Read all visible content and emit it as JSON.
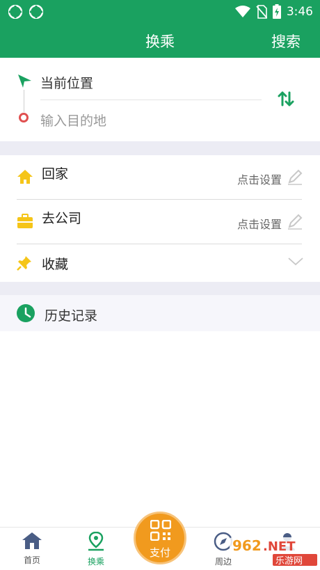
{
  "status_bar": {
    "time": "3:46",
    "icons": [
      "app-icon",
      "app-icon",
      "wifi-icon",
      "no-sim-icon",
      "battery-charging-icon"
    ]
  },
  "header": {
    "title": "换乘",
    "search_label": "搜索"
  },
  "route": {
    "from_label": "当前位置",
    "to_placeholder": "输入目的地",
    "swap_icon": "swap-vertical-icon"
  },
  "places": [
    {
      "name": "回家",
      "hint": "点击设置",
      "icon": "home-icon"
    },
    {
      "name": "去公司",
      "hint": "点击设置",
      "icon": "briefcase-icon"
    },
    {
      "name": "收藏",
      "icon": "pin-icon"
    }
  ],
  "history": {
    "label": "历史记录",
    "icon": "clock-icon"
  },
  "bottom_nav": {
    "tabs": [
      {
        "label": "首页",
        "icon": "home-icon"
      },
      {
        "label": "换乘",
        "icon": "location-route-icon",
        "active": true
      },
      {
        "label": "周边",
        "icon": "compass-icon"
      },
      {
        "label": "",
        "icon": "user-icon"
      }
    ],
    "pay_label": "支付"
  },
  "colors": {
    "primary": "#1aa160",
    "pay": "#f19a1e",
    "home_icon": "#f5c518",
    "destination": "#e05050"
  }
}
